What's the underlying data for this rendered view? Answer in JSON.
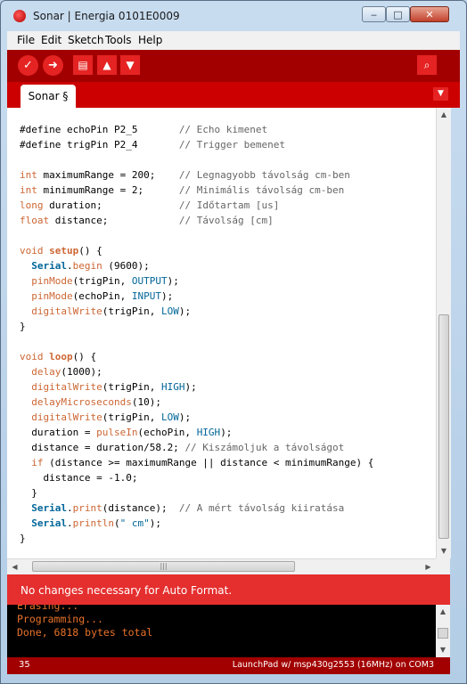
{
  "window": {
    "title": "Sonar | Energia 0101E0009",
    "controls": {
      "minimize": "‒",
      "maximize": "□",
      "close": "✕"
    }
  },
  "menu": [
    "File",
    "Edit",
    "Sketch",
    "Tools",
    "Help"
  ],
  "toolbar": {
    "verify": "✓",
    "upload": "➜",
    "new": "▤",
    "open": "▲",
    "save": "▼",
    "serial_monitor": "⌕"
  },
  "tab": {
    "label": "Sonar §",
    "menu_glyph": "▼"
  },
  "code": [
    [],
    [
      [
        "t",
        "#define echoPin P2_5       "
      ],
      [
        "cmt",
        "// Echo kimenet"
      ]
    ],
    [
      [
        "t",
        "#define trigPin P2_4       "
      ],
      [
        "cmt",
        "// Trigger bemenet"
      ]
    ],
    [],
    [
      [
        "kw",
        "int"
      ],
      [
        "t",
        " maximumRange = 200;    "
      ],
      [
        "cmt",
        "// Legnagyobb távolság cm-ben"
      ]
    ],
    [
      [
        "kw",
        "int"
      ],
      [
        "t",
        " minimumRange = 2;      "
      ],
      [
        "cmt",
        "// Minimális távolság cm-ben"
      ]
    ],
    [
      [
        "kw",
        "long"
      ],
      [
        "t",
        " duration;             "
      ],
      [
        "cmt",
        "// Időtartam [us]"
      ]
    ],
    [
      [
        "kw",
        "float"
      ],
      [
        "t",
        " distance;            "
      ],
      [
        "cmt",
        "// Távolság [cm]"
      ]
    ],
    [],
    [
      [
        "kw",
        "void"
      ],
      [
        "t",
        " "
      ],
      [
        "fnb",
        "setup"
      ],
      [
        "t",
        "() {"
      ]
    ],
    [
      [
        "t",
        "  "
      ],
      [
        "obj",
        "Serial"
      ],
      [
        "t",
        "."
      ],
      [
        "fn",
        "begin"
      ],
      [
        "t",
        " (9600);"
      ]
    ],
    [
      [
        "t",
        "  "
      ],
      [
        "fn",
        "pinMode"
      ],
      [
        "t",
        "(trigPin, "
      ],
      [
        "cst",
        "OUTPUT"
      ],
      [
        "t",
        ");"
      ]
    ],
    [
      [
        "t",
        "  "
      ],
      [
        "fn",
        "pinMode"
      ],
      [
        "t",
        "(echoPin, "
      ],
      [
        "cst",
        "INPUT"
      ],
      [
        "t",
        ");"
      ]
    ],
    [
      [
        "t",
        "  "
      ],
      [
        "fn",
        "digitalWrite"
      ],
      [
        "t",
        "(trigPin, "
      ],
      [
        "cst",
        "LOW"
      ],
      [
        "t",
        ");"
      ]
    ],
    [
      [
        "t",
        "}"
      ]
    ],
    [],
    [
      [
        "kw",
        "void"
      ],
      [
        "t",
        " "
      ],
      [
        "fnb",
        "loop"
      ],
      [
        "t",
        "() {"
      ]
    ],
    [
      [
        "t",
        "  "
      ],
      [
        "fn",
        "delay"
      ],
      [
        "t",
        "(1000);"
      ]
    ],
    [
      [
        "t",
        "  "
      ],
      [
        "fn",
        "digitalWrite"
      ],
      [
        "t",
        "(trigPin, "
      ],
      [
        "cst",
        "HIGH"
      ],
      [
        "t",
        ");"
      ]
    ],
    [
      [
        "t",
        "  "
      ],
      [
        "fn",
        "delayMicroseconds"
      ],
      [
        "t",
        "(10);"
      ]
    ],
    [
      [
        "t",
        "  "
      ],
      [
        "fn",
        "digitalWrite"
      ],
      [
        "t",
        "(trigPin, "
      ],
      [
        "cst",
        "LOW"
      ],
      [
        "t",
        ");"
      ]
    ],
    [
      [
        "t",
        "  duration = "
      ],
      [
        "fn",
        "pulseIn"
      ],
      [
        "t",
        "(echoPin, "
      ],
      [
        "cst",
        "HIGH"
      ],
      [
        "t",
        ");"
      ]
    ],
    [
      [
        "t",
        "  distance = duration/58.2; "
      ],
      [
        "cmt",
        "// Kiszámoljuk a távolságot"
      ]
    ],
    [
      [
        "t",
        "  "
      ],
      [
        "kw",
        "if"
      ],
      [
        "t",
        " (distance >= maximumRange || distance < minimumRange) {"
      ]
    ],
    [
      [
        "t",
        "    distance = -1.0;"
      ]
    ],
    [
      [
        "t",
        "  }"
      ]
    ],
    [
      [
        "t",
        "  "
      ],
      [
        "obj",
        "Serial"
      ],
      [
        "t",
        "."
      ],
      [
        "fn",
        "print"
      ],
      [
        "t",
        "(distance);  "
      ],
      [
        "cmt",
        "// A mért távolság kiiratása"
      ]
    ],
    [
      [
        "t",
        "  "
      ],
      [
        "obj",
        "Serial"
      ],
      [
        "t",
        "."
      ],
      [
        "fn",
        "println"
      ],
      [
        "t",
        "("
      ],
      [
        "str",
        "\" cm\""
      ],
      [
        "t",
        ");"
      ]
    ],
    [
      [
        "t",
        "}"
      ]
    ]
  ],
  "scroll": {
    "hgrip": "|||"
  },
  "status_message": "No changes necessary for Auto Format.",
  "console": [
    "Erasing...",
    "Programming...",
    "Done, 6818 bytes total"
  ],
  "footer": {
    "line_number": "35",
    "board": "LaunchPad w/ msp430g2553 (16MHz) on COM3"
  },
  "colors": {
    "toolbar": "#a20000",
    "tabbar": "#cc0000",
    "status": "#e52e2e",
    "keyword": "#cc6633",
    "constant": "#006699",
    "comment": "#666666",
    "console_text": "#e8722a"
  }
}
